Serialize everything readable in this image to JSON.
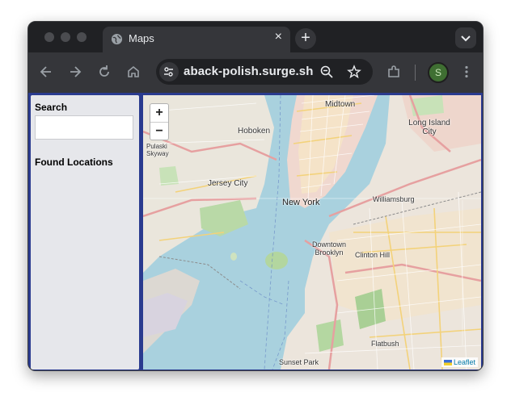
{
  "browser": {
    "tab_title": "Maps",
    "tab_close": "×",
    "new_tab": "+",
    "url": "aback-polish.surge.sh",
    "profile_initial": "S"
  },
  "sidebar": {
    "search_label": "Search",
    "search_value": "",
    "found_label": "Found Locations"
  },
  "map": {
    "zoom_in": "+",
    "zoom_out": "−",
    "attribution": "Leaflet",
    "labels": {
      "midtown": "Midtown",
      "hoboken": "Hoboken",
      "long_island_city": "Long Island City",
      "pulaski": "Pulaski Skyway",
      "jersey_city": "Jersey City",
      "new_york": "New York",
      "williamsburg": "Williamsburg",
      "downtown_brooklyn": "Downtown Brooklyn",
      "clinton_hill": "Clinton Hill",
      "flatbush": "Flatbush",
      "sunset_park": "Sunset Park"
    }
  }
}
